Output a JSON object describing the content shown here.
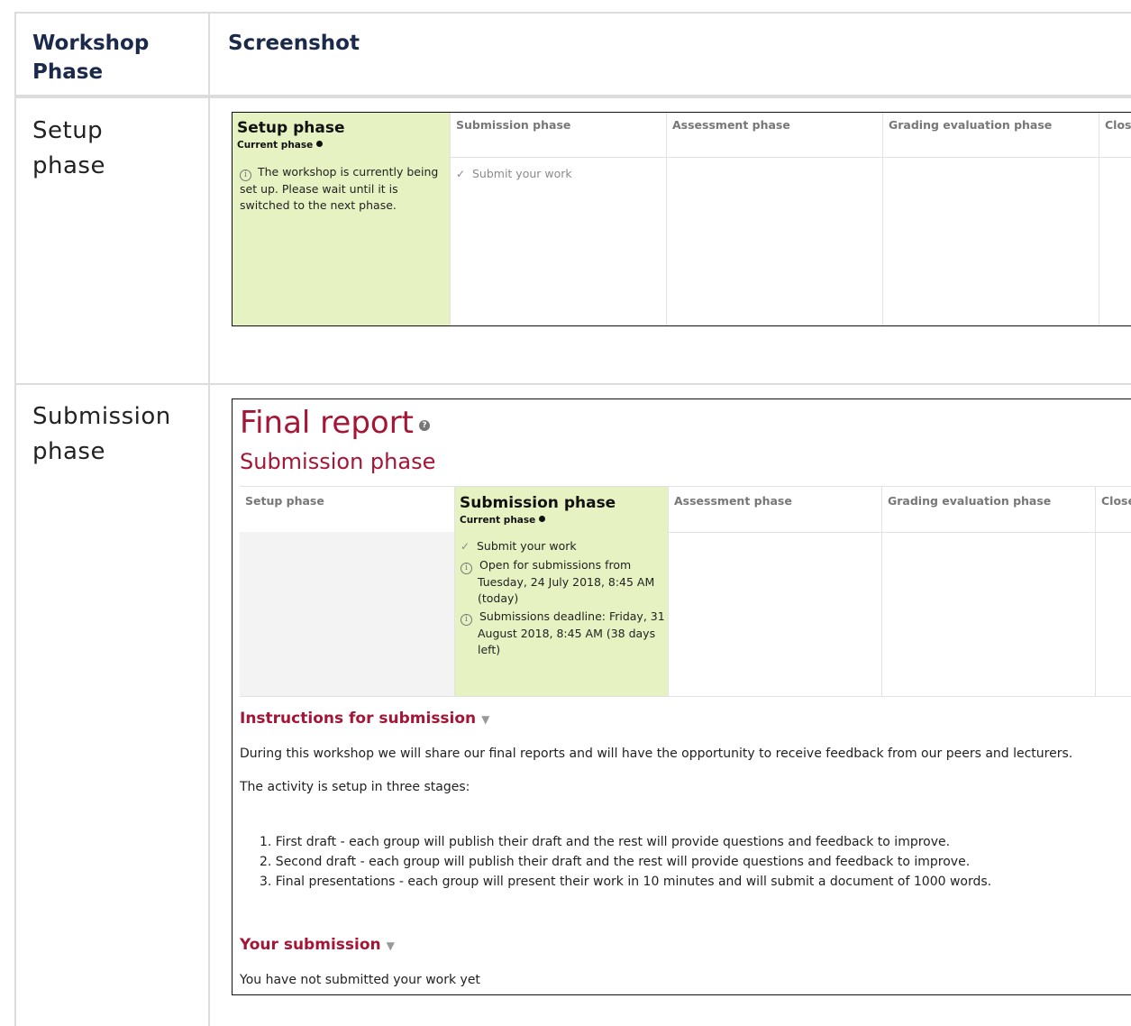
{
  "table": {
    "header": {
      "col1": "Workshop Phase",
      "col2": "Screenshot"
    },
    "rows": [
      {
        "phase": "Setup phase"
      },
      {
        "phase": "Submission phase"
      }
    ]
  },
  "setup_shot": {
    "active_title": "Setup phase",
    "current_label": "Current phase",
    "info_text": "The workshop is currently being set up. Please wait until it is switched to the next phase.",
    "other_phases": [
      "Submission phase",
      "Assessment phase",
      "Grading evaluation phase",
      "Closed"
    ],
    "submit_task": "Submit your work"
  },
  "submission_shot": {
    "page_title": "Final report",
    "page_subtitle": "Submission phase",
    "phases": {
      "setup": "Setup phase",
      "assessment": "Assessment phase",
      "grading": "Grading evaluation phase",
      "closed": "Closed"
    },
    "active_title": "Submission phase",
    "current_label": "Current phase",
    "tasks": [
      "Submit your work",
      "Open for submissions from Tuesday, 24 July 2018, 8:45 AM (today)",
      "Submissions deadline: Friday, 31 August 2018, 8:45 AM (38 days left)"
    ],
    "instructions_heading": "Instructions for submission",
    "instructions_p1": "During this workshop we will share our final reports and will have the opportunity to receive feedback from our peers and lecturers.",
    "instructions_p2": "The activity is setup in three stages:",
    "stages": [
      "1. First draft - each group will publish their draft and the rest will provide questions and feedback to improve.",
      "2. Second draft - each group will publish their draft and the rest will provide questions and feedback to improve.",
      "3. Final presentations - each group will present their work in 10 minutes and will submit a document of 1000 words."
    ],
    "your_submission_heading": "Your submission",
    "no_submission_text": "You have not submitted your work yet"
  },
  "colors": {
    "accent": "#a51535",
    "active_phase_bg": "#e6f2c2",
    "header_text": "#1b2a4a"
  }
}
